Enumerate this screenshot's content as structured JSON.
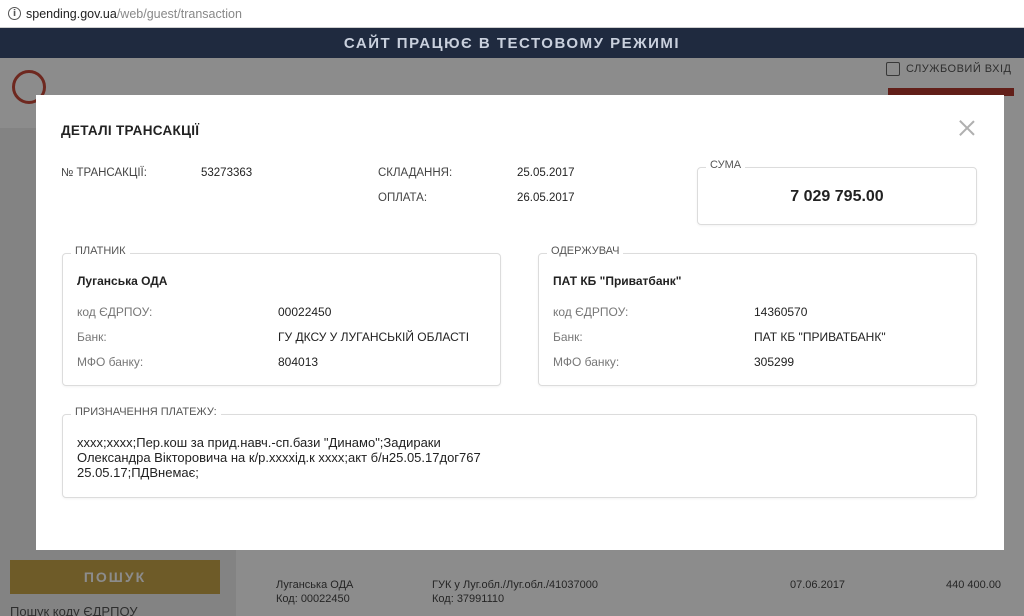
{
  "browser": {
    "url_host": "spending.gov.ua",
    "url_path": "/web/guest/transaction"
  },
  "banner": {
    "text": "САЙТ ПРАЦЮЄ В ТЕСТОВОМУ РЕЖИМІ"
  },
  "header": {
    "login_label": "СЛУЖБОВИЙ ВХІД"
  },
  "sidebar": {
    "search_button": "ПОШУК",
    "edrpou_search": "Пошук коду ЄДРПОУ"
  },
  "background_row": {
    "payer": "Луганська ОДА",
    "payer_code": "Код: 00022450",
    "recipient": "ГУК у Луг.обл./Луг.обл./41037000",
    "recipient_code": "Код: 37991110",
    "date": "07.06.2017",
    "amount": "440 400.00"
  },
  "modal": {
    "title": "ДЕТАЛІ ТРАНСАКЦІЇ",
    "transaction_no_label": "№ ТРАНСАКЦІЇ:",
    "transaction_no": "53273363",
    "compiled_label": "СКЛАДАННЯ:",
    "compiled_date": "25.05.2017",
    "paid_label": "ОПЛАТА:",
    "paid_date": "26.05.2017",
    "sum_legend": "СУМА",
    "sum_value": "7 029 795.00",
    "payer": {
      "legend": "ПЛАТНИК",
      "name": "Луганська ОДА",
      "edrpou_label": "код ЄДРПОУ:",
      "edrpou": "00022450",
      "bank_label": "Банк:",
      "bank": "ГУ ДКСУ У ЛУГАНСЬКІЙ ОБЛАСТІ",
      "mfo_label": "МФО банку:",
      "mfo": "804013"
    },
    "recipient": {
      "legend": "ОДЕРЖУВАЧ",
      "name": "ПАТ КБ \"Приватбанк\"",
      "edrpou_label": "код ЄДРПОУ:",
      "edrpou": "14360570",
      "bank_label": "Банк:",
      "bank": "ПАТ КБ \"ПРИВАТБАНК\"",
      "mfo_label": "МФО банку:",
      "mfo": "305299"
    },
    "purpose": {
      "legend": "ПРИЗНАЧЕННЯ ПЛАТЕЖУ:",
      "text": "хххх;хххх;Пер.кош за прид.навч.-сп.бази \"Динамо\";Задираки Олександра Вікторовича на к/р.ххххід.к хххх;акт б/н25.05.17дог767 25.05.17;ПДВнемає;"
    }
  }
}
